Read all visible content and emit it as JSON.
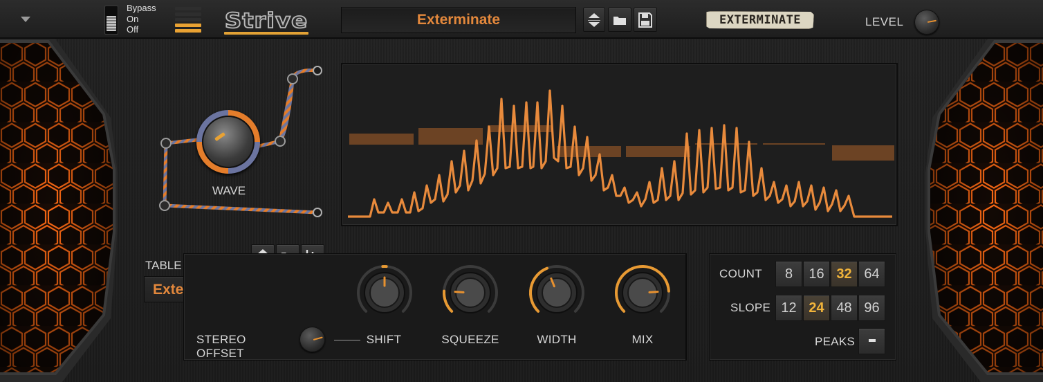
{
  "header": {
    "bypass": {
      "labels": [
        "Bypass",
        "On",
        "Off"
      ],
      "state": "Off"
    },
    "logo": "Strive",
    "preset_name": "Exterminate",
    "tag_label": "EXTERMINATE",
    "level_label": "LEVEL",
    "icons": [
      "menu-arrow-icon",
      "equalizer-icon",
      "up-down-arrows-icon",
      "folder-icon",
      "save-icon"
    ]
  },
  "wave": {
    "label": "WAVE"
  },
  "table": {
    "label": "TABLE",
    "name": "Exterminate",
    "icons": [
      "up-down-arrows-icon",
      "folder-icon",
      "waveform-import-icon",
      "pencil-icon",
      "close-icon"
    ]
  },
  "modulation": {
    "stereo_offset_label": "STEREO OFFSET",
    "knobs": [
      {
        "id": "shift",
        "label": "SHIFT",
        "value": 0.5
      },
      {
        "id": "squeeze",
        "label": "SQUEEZE",
        "value": 0.18
      },
      {
        "id": "width",
        "label": "WIDTH",
        "value": 0.42
      },
      {
        "id": "mix",
        "label": "MIX",
        "value": 0.82
      }
    ]
  },
  "spectrum": {
    "count_label": "COUNT",
    "count_options": [
      "8",
      "16",
      "32",
      "64"
    ],
    "count_selected": "32",
    "slope_label": "SLOPE",
    "slope_options": [
      "12",
      "24",
      "48",
      "96"
    ],
    "slope_selected": "24",
    "peaks_label": "PEAKS",
    "peaks_state": "off"
  },
  "colors": {
    "accent": "#e47d2b",
    "highlight": "#f2b43a",
    "background": "#1c1c1c",
    "hex_glow": "#ff7a1a"
  }
}
